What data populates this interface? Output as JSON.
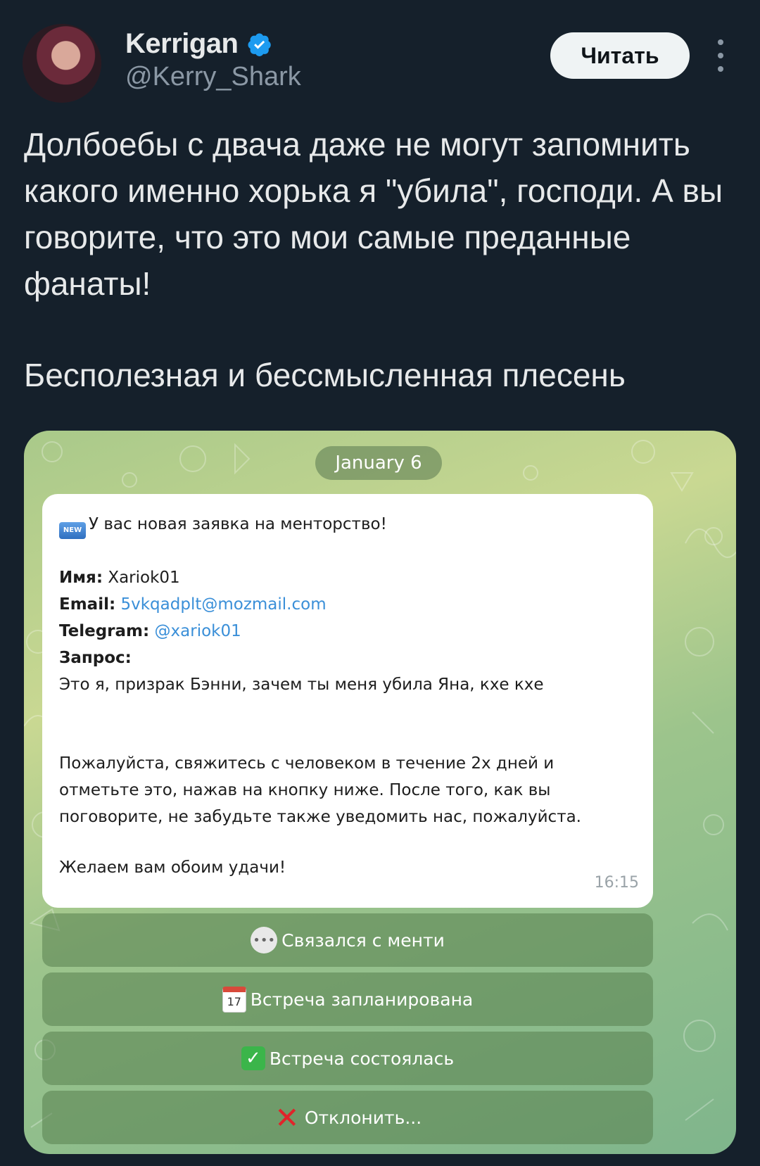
{
  "author": {
    "name": "Kerrigan",
    "handle": "@Kerry_Shark",
    "follow_label": "Читать"
  },
  "tweet": {
    "paragraph1": "Долбоебы с двача даже не могут запомнить какого именно хорька я \"убила\", господи. А вы говорите, что это мои самые преданные фанаты!",
    "paragraph2": "Бесполезная и бессмысленная плесень"
  },
  "media": {
    "date_chip": "January 6",
    "message": {
      "badge": "NEW",
      "header": "У вас новая заявка на менторство!",
      "name_label": "Имя:",
      "name_value": "Xariok01",
      "email_label": "Email:",
      "email_value": "5vkqadplt@mozmail.com",
      "telegram_label": "Telegram:",
      "telegram_value": "@xariok01",
      "request_label": "Запрос:",
      "request_value": "Это я, призрак Бэнни, зачем ты меня убила Яна, кхе кхе",
      "body_line1": "Пожалуйста, свяжитесь с человеком в течение 2х дней и",
      "body_line2": "отметьте это, нажав на кнопку ниже. После того, как вы",
      "body_line3": "поговорите, не забудьте также уведомить нас, пожалуйста.",
      "closing": "Желаем вам обоим удачи!",
      "time": "16:15"
    },
    "buttons": [
      {
        "label": "Связался с менти",
        "icon": "chat-bubble-icon"
      },
      {
        "label": "Встреча запланирована",
        "icon": "calendar-icon"
      },
      {
        "label": "Встреча состоялась",
        "icon": "check-mark-icon"
      },
      {
        "label": "Отклонить...",
        "icon": "cross-mark-icon"
      }
    ]
  },
  "colors": {
    "background": "#15202b",
    "link": "#3a8fd8",
    "verified": "#1d9bf0"
  }
}
